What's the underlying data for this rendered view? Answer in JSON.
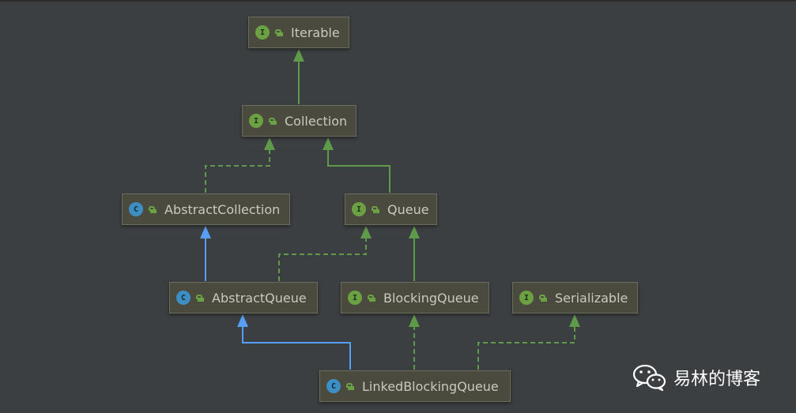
{
  "diagram": {
    "nodes": [
      {
        "id": "iterable",
        "kind": "interface",
        "kind_letter": "I",
        "label": "Iterable"
      },
      {
        "id": "collection",
        "kind": "interface",
        "kind_letter": "I",
        "label": "Collection"
      },
      {
        "id": "abstract-collection",
        "kind": "class",
        "kind_letter": "C",
        "label": "AbstractCollection"
      },
      {
        "id": "queue",
        "kind": "interface",
        "kind_letter": "I",
        "label": "Queue"
      },
      {
        "id": "abstract-queue",
        "kind": "class",
        "kind_letter": "C",
        "label": "AbstractQueue"
      },
      {
        "id": "blocking-queue",
        "kind": "interface",
        "kind_letter": "I",
        "label": "BlockingQueue"
      },
      {
        "id": "serializable",
        "kind": "interface",
        "kind_letter": "I",
        "label": "Serializable"
      },
      {
        "id": "linked-blocking-queue",
        "kind": "class",
        "kind_letter": "C",
        "label": "LinkedBlockingQueue"
      }
    ],
    "edges": [
      {
        "from": "collection",
        "to": "iterable",
        "type": "extends"
      },
      {
        "from": "abstract-collection",
        "to": "collection",
        "type": "implements"
      },
      {
        "from": "queue",
        "to": "collection",
        "type": "extends"
      },
      {
        "from": "abstract-queue",
        "to": "abstract-collection",
        "type": "class-extends"
      },
      {
        "from": "abstract-queue",
        "to": "queue",
        "type": "implements"
      },
      {
        "from": "blocking-queue",
        "to": "queue",
        "type": "extends"
      },
      {
        "from": "linked-blocking-queue",
        "to": "abstract-queue",
        "type": "class-extends"
      },
      {
        "from": "linked-blocking-queue",
        "to": "blocking-queue",
        "type": "implements"
      },
      {
        "from": "linked-blocking-queue",
        "to": "serializable",
        "type": "implements"
      }
    ],
    "colors": {
      "background": "#3c3f41",
      "interface_edge": "#5f9a4a",
      "class_edge": "#589df6",
      "interface_badge": "#6ba143",
      "class_badge": "#3d8ec2"
    }
  },
  "watermark": {
    "icon": "wechat-icon",
    "text": "易林的博客"
  }
}
